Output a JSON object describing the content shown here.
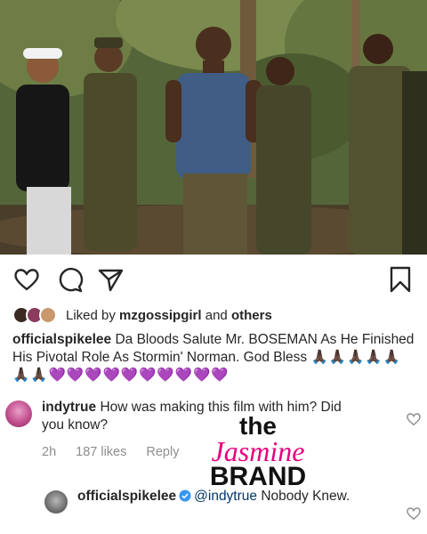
{
  "post": {
    "liked_by_prefix": "Liked by",
    "liked_by_user": "mzgossipgirl",
    "liked_by_and": "and",
    "liked_by_others": "others",
    "author": "officialspikelee",
    "caption": "Da Bloods Salute Mr. BOSEMAN As He Finished His Pivotal Role As Stormin' Norman. God Bless",
    "caption_emojis": "🙏🏿🙏🏿🙏🏿🙏🏿🙏🏿🙏🏿🙏🏿💜💜💜💜💜💜💜💜💜💜",
    "icons": [
      "heart-icon",
      "comment-icon",
      "share-icon",
      "bookmark-icon"
    ]
  },
  "comment": {
    "username": "indytrue",
    "text": "How was making this film with him? Did you know?",
    "time": "2h",
    "likes": "187 likes",
    "reply_label": "Reply"
  },
  "reply": {
    "username": "officialspikelee",
    "mention": "@indytrue",
    "text": "Nobody Knew."
  },
  "watermark": {
    "line1": "the",
    "line2": "Jasmine",
    "line3": "BRAND"
  },
  "colors": {
    "text": "#262626",
    "muted": "#8e8e8e",
    "verified": "#3897f0",
    "brand_pink": "#e6007e"
  }
}
